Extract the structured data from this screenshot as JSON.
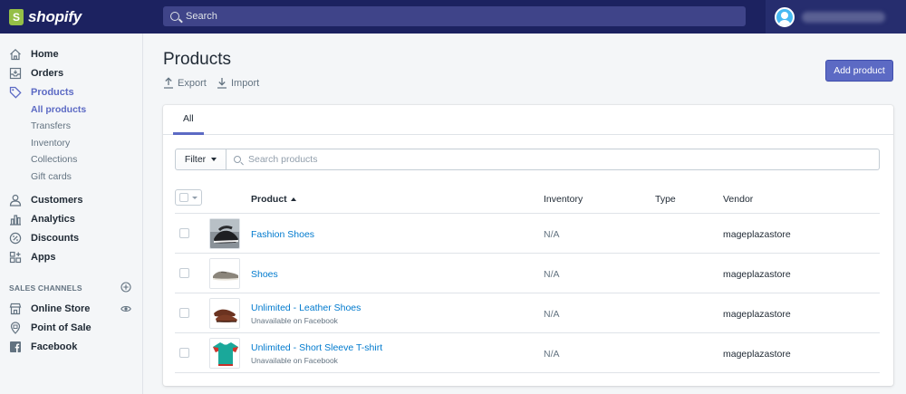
{
  "topbar": {
    "logo_text": "shopify",
    "search_placeholder": "Search"
  },
  "sidebar": {
    "items": [
      {
        "label": "Home",
        "icon": "home-icon"
      },
      {
        "label": "Orders",
        "icon": "orders-icon"
      },
      {
        "label": "Products",
        "icon": "tag-icon",
        "active": true
      },
      {
        "label": "Customers",
        "icon": "customers-icon"
      },
      {
        "label": "Analytics",
        "icon": "analytics-icon"
      },
      {
        "label": "Discounts",
        "icon": "discounts-icon"
      },
      {
        "label": "Apps",
        "icon": "apps-icon"
      }
    ],
    "product_subitems": [
      {
        "label": "All products",
        "active": true
      },
      {
        "label": "Transfers"
      },
      {
        "label": "Inventory"
      },
      {
        "label": "Collections"
      },
      {
        "label": "Gift cards"
      }
    ],
    "sales_channels_label": "SALES CHANNELS",
    "channels": [
      {
        "label": "Online Store",
        "icon": "store-icon"
      },
      {
        "label": "Point of Sale",
        "icon": "pos-icon"
      },
      {
        "label": "Facebook",
        "icon": "facebook-icon"
      }
    ]
  },
  "page": {
    "title": "Products",
    "export_label": "Export",
    "import_label": "Import",
    "add_button": "Add product"
  },
  "tabs": [
    {
      "label": "All"
    }
  ],
  "filter": {
    "button_label": "Filter",
    "search_placeholder": "Search products"
  },
  "table": {
    "columns": [
      "Product",
      "Inventory",
      "Type",
      "Vendor"
    ],
    "rows": [
      {
        "name": "Fashion Shoes",
        "sub": "",
        "inventory": "N/A",
        "type": "",
        "vendor": "mageplazastore",
        "thumb": "fashion-shoes"
      },
      {
        "name": "Shoes",
        "sub": "",
        "inventory": "N/A",
        "type": "",
        "vendor": "mageplazastore",
        "thumb": "grey-shoe"
      },
      {
        "name": "Unlimited - Leather Shoes",
        "sub": "Unavailable on Facebook",
        "inventory": "N/A",
        "type": "",
        "vendor": "mageplazastore",
        "thumb": "leather-shoes"
      },
      {
        "name": "Unlimited - Short Sleeve T-shirt",
        "sub": "Unavailable on Facebook",
        "inventory": "N/A",
        "type": "",
        "vendor": "mageplazastore",
        "thumb": "tshirt"
      }
    ]
  },
  "colors": {
    "topbar": "#1c2260",
    "accent": "#5c6ac4",
    "link": "#007ace"
  }
}
